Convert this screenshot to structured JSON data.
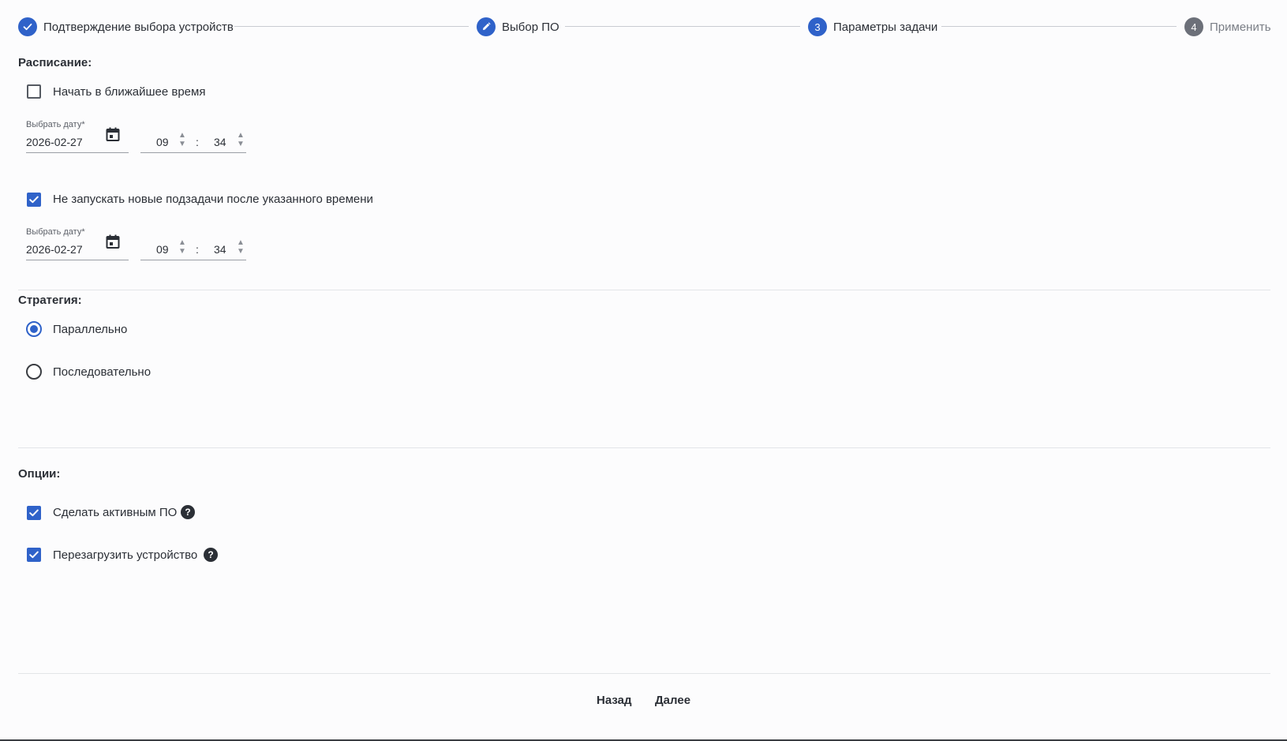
{
  "stepper": {
    "steps": [
      {
        "label": "Подтверждение выбора устройств",
        "icon": "check-icon",
        "state": "done"
      },
      {
        "label": "Выбор ПО",
        "icon": "pencil-icon",
        "state": "edited"
      },
      {
        "label": "Параметры задачи",
        "number": "3",
        "state": "current"
      },
      {
        "label": "Применить",
        "number": "4",
        "state": "pending"
      }
    ]
  },
  "schedule": {
    "title": "Расписание:",
    "start_asap": {
      "label": "Начать в ближайшее время",
      "checked": false
    },
    "start_date": {
      "label": "Выбрать дату*",
      "value": "2026-02-27",
      "hour": "09",
      "minute": "34"
    },
    "no_new_subtasks": {
      "label": "Не запускать новые подзадачи после указанного времени",
      "checked": true
    },
    "end_date": {
      "label": "Выбрать дату*",
      "value": "2026-02-27",
      "hour": "09",
      "minute": "34"
    },
    "time_separator": ":"
  },
  "strategy": {
    "title": "Стратегия:",
    "options": [
      {
        "label": "Параллельно",
        "selected": true
      },
      {
        "label": "Последовательно",
        "selected": false
      }
    ]
  },
  "options": {
    "title": "Опции:",
    "items": [
      {
        "label": "Сделать активным ПО",
        "checked": true,
        "help": "?"
      },
      {
        "label": "Перезагрузить устройство",
        "checked": true,
        "help": "?"
      }
    ]
  },
  "footer": {
    "back_label": "Назад",
    "next_label": "Далее"
  },
  "colors": {
    "accent": "#2f62c9",
    "inactive_step": "#6c7079"
  }
}
